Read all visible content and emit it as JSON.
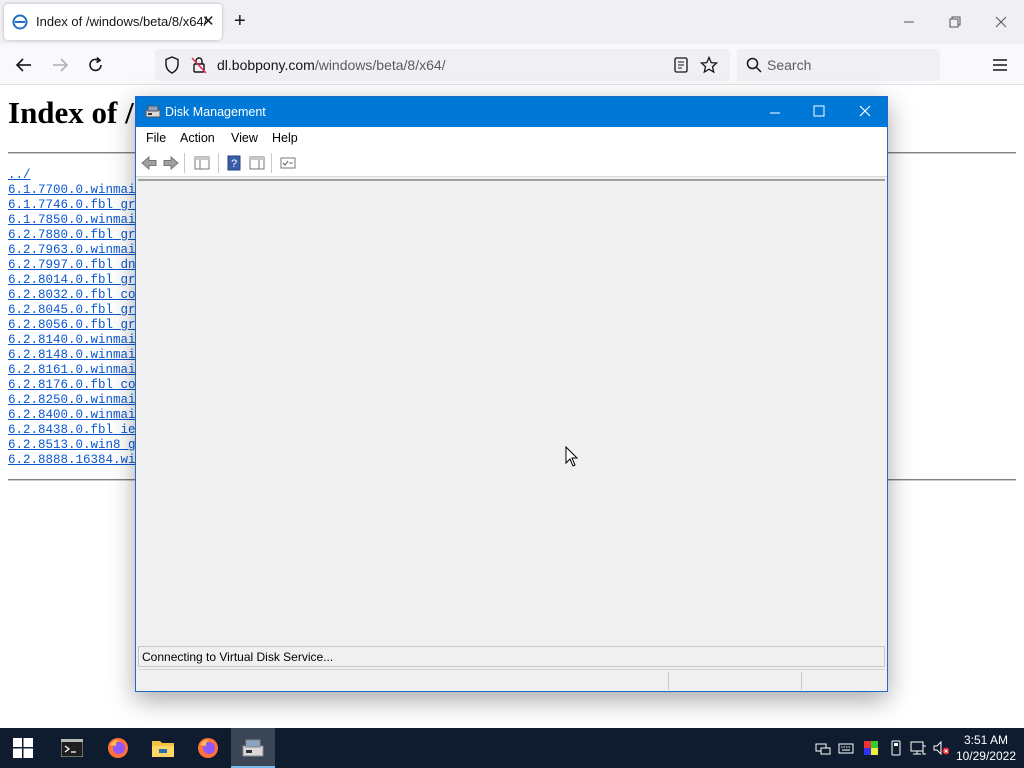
{
  "browser": {
    "tab_title": "Index of /windows/beta/8/x64/",
    "url_domain": "dl.bobpony.com",
    "url_path": "/windows/beta/8/x64/",
    "search_placeholder": "Search"
  },
  "page": {
    "heading": "Index of /",
    "links": [
      "../",
      "6.1.7700.0.winmain",
      "6.1.7746.0.fbl_grf",
      "6.1.7850.0.winmain",
      "6.2.7880.0.fbl_grf",
      "6.2.7963.0.winmain",
      "6.2.7997.0.fbl_dnt",
      "6.2.8014.0.fbl_grf",
      "6.2.8032.0.fbl_cor",
      "6.2.8045.0.fbl_grf",
      "6.2.8056.0.fbl_grf",
      "6.2.8140.0.winmain",
      "6.2.8148.0.winmain",
      "6.2.8161.0.winmain",
      "6.2.8176.0.fbl_cor",
      "6.2.8250.0.winmain",
      "6.2.8400.0.winmain",
      "6.2.8438.0.fbl_ie_",
      "6.2.8513.0.win8_gd",
      "6.2.8888.16384.win"
    ]
  },
  "disk_management": {
    "title": "Disk Management",
    "menu": [
      "File",
      "Action",
      "View",
      "Help"
    ],
    "status_text": "Connecting to Virtual Disk Service..."
  },
  "taskbar": {
    "time": "3:51 AM",
    "date": "10/29/2022"
  },
  "colors": {
    "titlebar": "#0078d7",
    "taskbar": "#0f1c30",
    "link": "#0b57d0"
  }
}
